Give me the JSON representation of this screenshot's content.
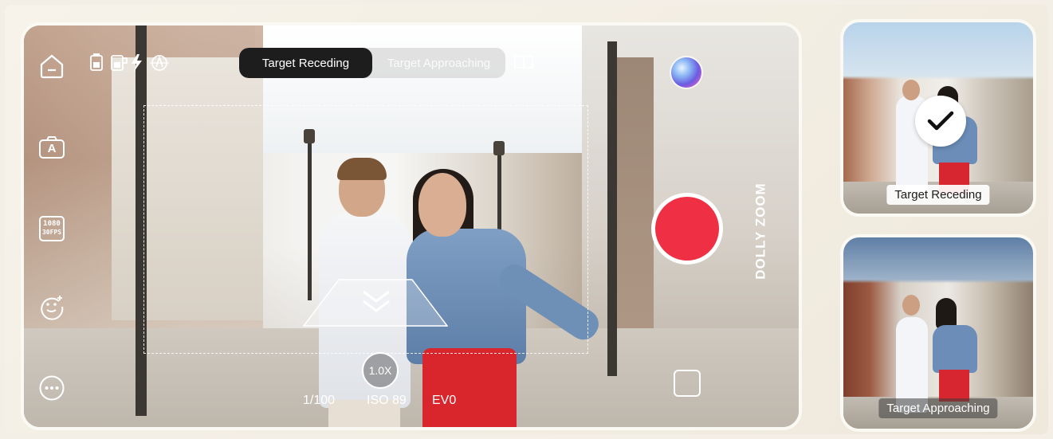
{
  "mode_selector": {
    "options": [
      "Target Receding",
      "Target Approaching"
    ],
    "selected": "Target Receding"
  },
  "mode_title": "DOLLY ZOOM",
  "left_toolbar": {
    "icons": [
      "home-icon",
      "auto-mode-icon",
      "resolution-icon",
      "face-tracking-icon",
      "more-icon"
    ],
    "resolution_line1": "1080",
    "resolution_line2": "30FPS",
    "auto_glyph": "A"
  },
  "status_icons": [
    "phone-battery-icon",
    "gimbal-battery-icon",
    "flash-icon",
    "gimbal-mode-icon"
  ],
  "zoom": "1.0X",
  "readout": {
    "shutter": "1/100",
    "iso": "ISO 89",
    "ev": "EV0"
  },
  "thumbnails": [
    {
      "label": "Target Receding",
      "selected": true
    },
    {
      "label": "Target Approaching",
      "selected": false
    }
  ],
  "colors": {
    "record": "#ef3044",
    "segment_active": "#1d1d1d",
    "background": "#f3efe6"
  }
}
